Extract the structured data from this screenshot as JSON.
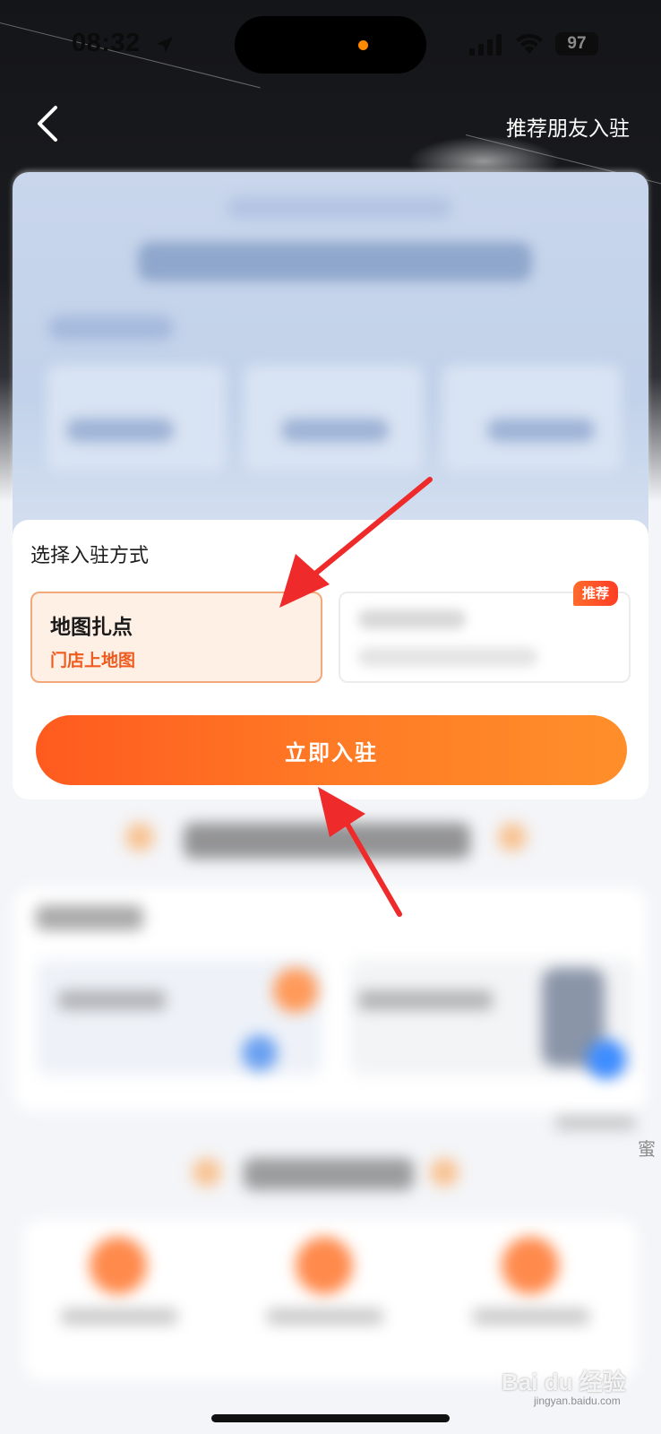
{
  "status_bar": {
    "time": "08:32",
    "battery": "97",
    "icons": [
      "location-arrow-icon",
      "signal-icon",
      "wifi-icon",
      "battery-icon"
    ]
  },
  "nav": {
    "back_icon": "chevron-left-icon",
    "recommend_link": "推荐朋友入驻"
  },
  "join": {
    "section_title": "选择入驻方式",
    "options": [
      {
        "title": "地图扎点",
        "subtitle": "门店上地图",
        "selected": true
      },
      {
        "title": "",
        "subtitle": "",
        "selected": false
      }
    ],
    "recommend_badge": "推荐",
    "submit_label": "立即入驻"
  },
  "side_char": "蜜",
  "watermark": {
    "brand": "Bai du 经验",
    "url": "jingyan.baidu.com"
  },
  "colors": {
    "accent": "#ff6a22",
    "accent_light": "#fff0e6",
    "badge": "#ff4a26",
    "annotation": "#ee2a2a",
    "dark_header": "#17181c"
  }
}
